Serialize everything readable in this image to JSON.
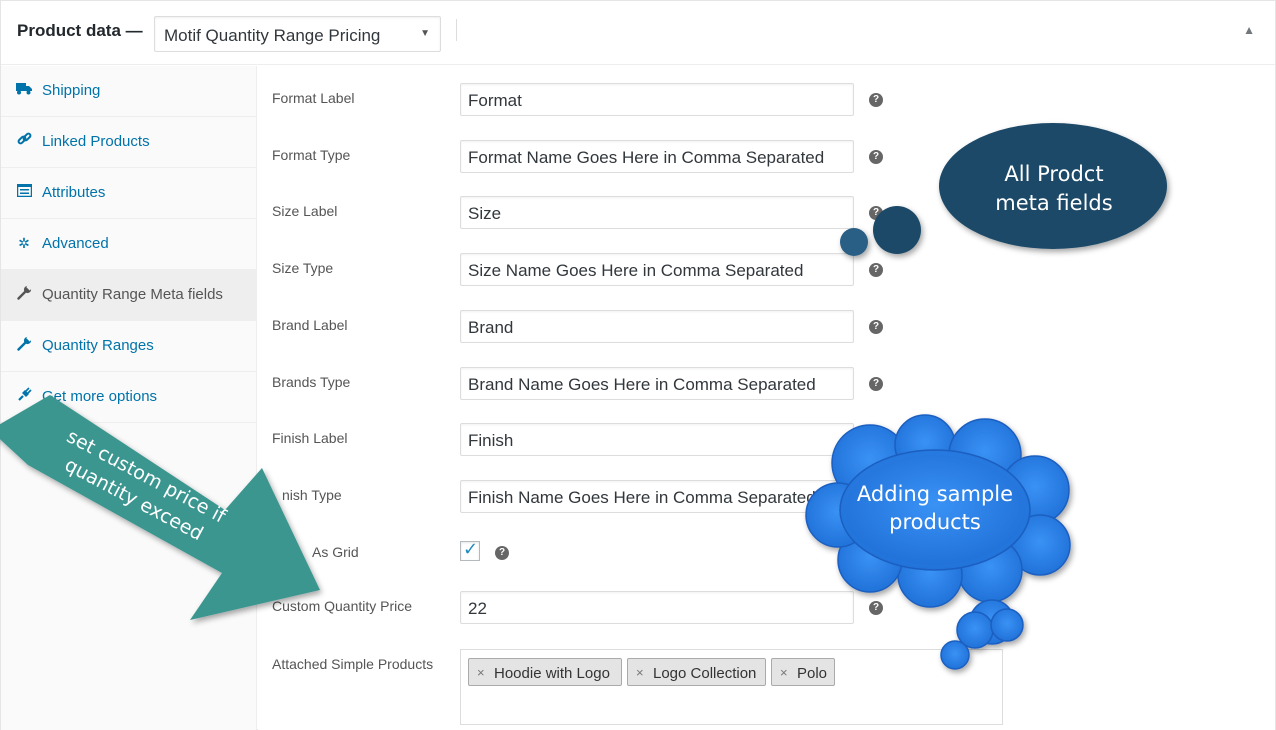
{
  "header": {
    "title": "Product data —",
    "product_type": "Motif Quantity Range Pricing"
  },
  "sidebar": {
    "items": [
      {
        "label": "Shipping"
      },
      {
        "label": "Linked Products"
      },
      {
        "label": "Attributes"
      },
      {
        "label": "Advanced"
      },
      {
        "label": "Quantity Range Meta fields"
      },
      {
        "label": "Quantity Ranges"
      },
      {
        "label": "Get more options"
      }
    ]
  },
  "fields": {
    "format_label": {
      "label": "Format Label",
      "value": "Format"
    },
    "format_type": {
      "label": "Format Type",
      "value": "Format Name Goes Here in Comma Separated"
    },
    "size_label": {
      "label": "Size Label",
      "value": "Size"
    },
    "size_type": {
      "label": "Size Type",
      "value": "Size Name Goes Here in Comma Separated"
    },
    "brand_label": {
      "label": "Brand Label",
      "value": "Brand"
    },
    "brands_type": {
      "label": "Brands Type",
      "value": "Brand Name Goes Here in Comma Separated"
    },
    "finish_label": {
      "label": "Finish Label",
      "value": "Finish"
    },
    "finish_type": {
      "label": "nish Type",
      "value": "Finish Name Goes Here in Comma Separated"
    },
    "show_grid": {
      "label": "As Grid",
      "checked": true
    },
    "custom_price": {
      "label": "Custom Quantity Price",
      "value": "22"
    },
    "attached": {
      "label": "Attached Simple Products",
      "tags": [
        "Hoodie with Logo",
        "Logo Collection",
        "Polo"
      ]
    }
  },
  "annotations": {
    "meta_bubble": [
      "All Prodct",
      "meta fields"
    ],
    "cloud": [
      "Adding sample",
      "products"
    ],
    "arrow": [
      "set custom price if",
      "quantity exceed"
    ]
  },
  "colors": {
    "link": "#0073aa",
    "meta_bubble": "#1c4a68",
    "cloud": "#2f86f0",
    "arrow": "#3a9690"
  }
}
